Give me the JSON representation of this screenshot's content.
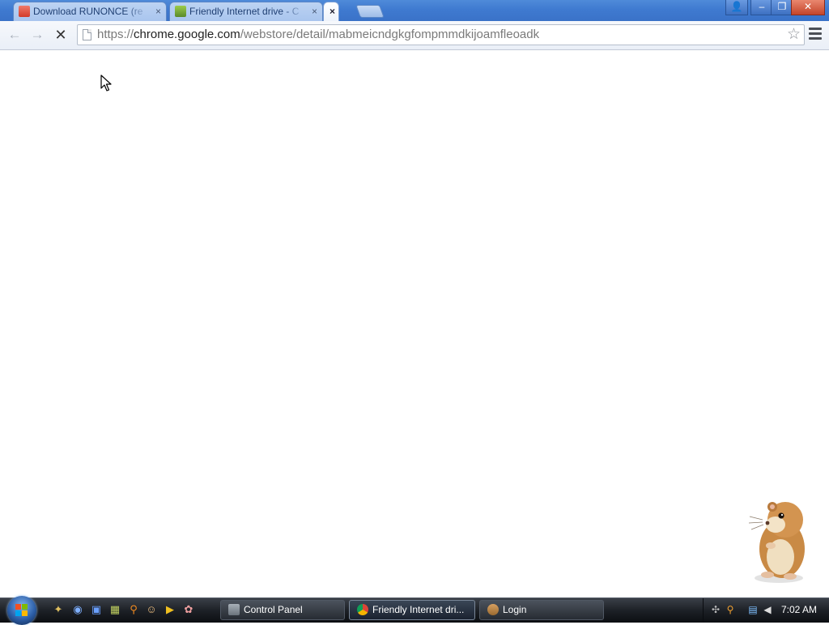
{
  "browser": {
    "tabs": [
      {
        "title": "Download RUNONCE (re",
        "favicon": "store-favicon",
        "close": "×"
      },
      {
        "title": "Friendly Internet drive - C",
        "favicon": "extension-favicon",
        "close": "×"
      },
      {
        "title": "",
        "close": "×"
      }
    ],
    "window_controls": {
      "profile": "👤",
      "minimize": "–",
      "maximize": "❐",
      "close": "✕"
    },
    "toolbar": {
      "back": "←",
      "forward": "→",
      "stop": "✕",
      "url_scheme": "https://",
      "url_host": "chrome.google.com",
      "url_path": "/webstore/detail/mabmeicndgkgfompmmdkijoamfleoadk",
      "bookmark_star": "☆"
    }
  },
  "taskbar": {
    "buttons": [
      {
        "label": "Control Panel"
      },
      {
        "label": "Friendly Internet dri..."
      },
      {
        "label": "Login"
      }
    ],
    "clock": "7:02 AM"
  },
  "colors": {
    "titlebar": "#3f7ad0",
    "taskbar": "#1d2127",
    "accent": "#4f8bd9"
  }
}
